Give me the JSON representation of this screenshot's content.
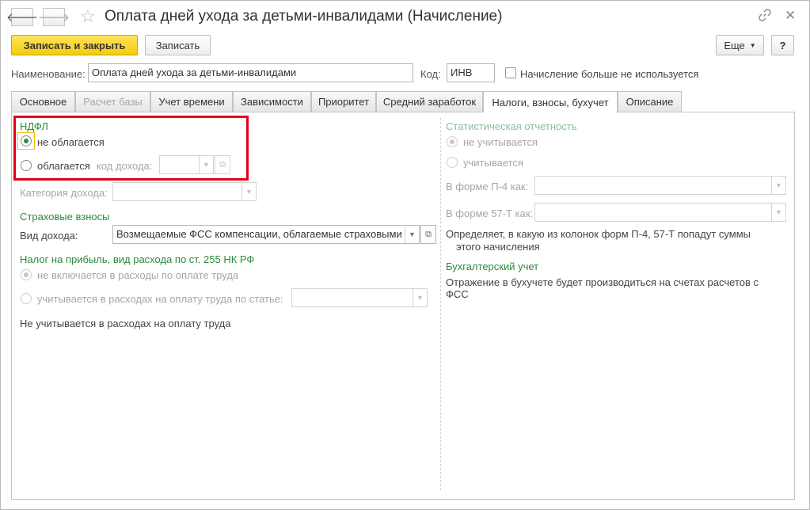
{
  "window": {
    "title": "Оплата дней ухода за детьми-инвалидами (Начисление)"
  },
  "toolbar": {
    "save_close_label": "Записать и закрыть",
    "save_label": "Записать",
    "more_label": "Еще",
    "help_label": "?"
  },
  "header": {
    "name_label": "Наименование:",
    "name_value": "Оплата дней ухода за детьми-инвалидами",
    "code_label": "Код:",
    "code_value": "ИНВ",
    "unused_label": "Начисление больше не используется"
  },
  "tabs": [
    {
      "label": "Основное"
    },
    {
      "label": "Расчет базы"
    },
    {
      "label": "Учет времени"
    },
    {
      "label": "Зависимости"
    },
    {
      "label": "Приоритет"
    },
    {
      "label": "Средний заработок"
    },
    {
      "label": "Налоги, взносы, бухучет"
    },
    {
      "label": "Описание"
    }
  ],
  "ndfl": {
    "title": "НДФЛ",
    "option_not_taxed": "не облагается",
    "option_taxed": "облагается",
    "income_code_label": "код дохода:",
    "income_code_value": "",
    "category_label": "Категория дохода:",
    "category_value": ""
  },
  "insurance": {
    "title": "Страховые взносы",
    "income_type_label": "Вид дохода:",
    "income_type_value": "Возмещаемые ФСС компенсации, облагаемые страховыми"
  },
  "profit_tax": {
    "title": "Налог на прибыль, вид расхода по ст. 255 НК РФ",
    "option_not_included": "не включается в расходы по оплате труда",
    "option_included": "учитывается в расходах на оплату труда по статье:",
    "article_value": "",
    "note": "Не учитывается в расходах на оплату труда"
  },
  "stat_reporting": {
    "title": "Статистическая отчетность",
    "option_not_counted": "не учитывается",
    "option_counted": "учитывается",
    "p4_label": "В форме П-4 как:",
    "p4_value": "",
    "t57_label": "В форме 57-Т как:",
    "t57_value": "",
    "note_line1": "Определяет, в какую из колонок форм П-4, 57-Т попадут суммы",
    "note_line2": "этого начисления"
  },
  "accounting": {
    "title": "Бухгалтерский учет",
    "note_line1": "Отражение в бухучете будет производиться на счетах расчетов с",
    "note_line2": "ФСС"
  }
}
